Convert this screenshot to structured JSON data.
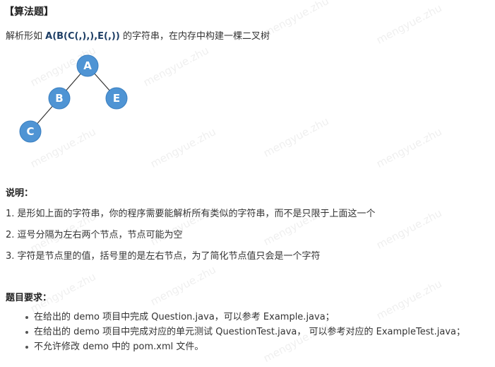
{
  "heading": "【算法题】",
  "intro": {
    "prefix": "解析形如 ",
    "code": "A(B(C(,),),E(,))",
    "suffix": " 的字符串，在内存中构建一棵二叉树"
  },
  "tree": {
    "nodes": [
      {
        "id": "A",
        "label": "A"
      },
      {
        "id": "B",
        "label": "B"
      },
      {
        "id": "E",
        "label": "E"
      },
      {
        "id": "C",
        "label": "C"
      }
    ],
    "edges": [
      [
        "A",
        "B"
      ],
      [
        "A",
        "E"
      ],
      [
        "B",
        "C"
      ]
    ],
    "node_color": "#4f94d4",
    "node_border": "#3a7fc0",
    "edge_color": "#333333"
  },
  "explanation": {
    "title": "说明：",
    "items": [
      "1. 是形如上面的字符串，你的程序需要能解析所有类似的字符串，而不是只限于上面这一个",
      "2. 逗号分隔为左右两个节点，节点可能为空",
      "3. 字符是节点里的值，括号里的是左右节点，为了简化节点值只会是一个字符"
    ]
  },
  "requirements": {
    "title": "题目要求：",
    "items": [
      "在给出的 demo 项目中完成 Question.java，可以参考 Example.java；",
      "在给出的 demo 项目中完成对应的单元测试 QuestionTest.java，  可以参考对应的 ExampleTest.java；",
      "不允许修改 demo 中的 pom.xml 文件。"
    ]
  },
  "watermark": "mengyue.zhu"
}
